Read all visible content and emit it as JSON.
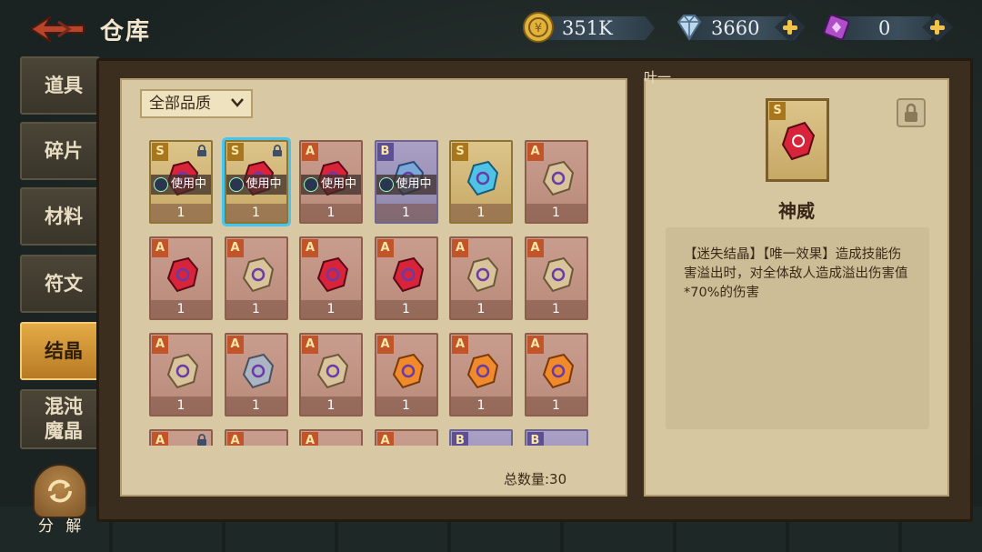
{
  "header": {
    "title": "仓库",
    "gold": "351K",
    "diamonds": "3660",
    "crystals": "0"
  },
  "tabs": [
    {
      "label": "道具",
      "active": false
    },
    {
      "label": "碎片",
      "active": false
    },
    {
      "label": "材料",
      "active": false
    },
    {
      "label": "符文",
      "active": false
    },
    {
      "label": "结晶",
      "active": true
    },
    {
      "label": "混沌魔晶",
      "active": false
    }
  ],
  "decompose_label": "分 解",
  "panel_tag": "叶一",
  "filter": {
    "quality_label": "全部品质"
  },
  "inuse_label": "使用中",
  "items": [
    {
      "rarity": "S",
      "gem": "red",
      "count": "1",
      "in_use": true,
      "locked": true,
      "selected": false
    },
    {
      "rarity": "S",
      "gem": "red",
      "count": "1",
      "in_use": true,
      "locked": true,
      "selected": true
    },
    {
      "rarity": "A",
      "gem": "red",
      "count": "1",
      "in_use": true,
      "locked": false,
      "selected": false
    },
    {
      "rarity": "B",
      "gem": "blue",
      "count": "1",
      "in_use": true,
      "locked": false,
      "selected": false
    },
    {
      "rarity": "S",
      "gem": "cyan",
      "count": "1",
      "in_use": false,
      "locked": false,
      "selected": false
    },
    {
      "rarity": "A",
      "gem": "tan",
      "count": "1",
      "in_use": false,
      "locked": false,
      "selected": false
    },
    {
      "rarity": "A",
      "gem": "red",
      "count": "1",
      "in_use": false,
      "locked": false,
      "selected": false
    },
    {
      "rarity": "A",
      "gem": "tan",
      "count": "1",
      "in_use": false,
      "locked": false,
      "selected": false
    },
    {
      "rarity": "A",
      "gem": "red",
      "count": "1",
      "in_use": false,
      "locked": false,
      "selected": false
    },
    {
      "rarity": "A",
      "gem": "red",
      "count": "1",
      "in_use": false,
      "locked": false,
      "selected": false
    },
    {
      "rarity": "A",
      "gem": "tan",
      "count": "1",
      "in_use": false,
      "locked": false,
      "selected": false
    },
    {
      "rarity": "A",
      "gem": "tan",
      "count": "1",
      "in_use": false,
      "locked": false,
      "selected": false
    },
    {
      "rarity": "A",
      "gem": "tan",
      "count": "1",
      "in_use": false,
      "locked": false,
      "selected": false
    },
    {
      "rarity": "A",
      "gem": "silver",
      "count": "1",
      "in_use": false,
      "locked": false,
      "selected": false
    },
    {
      "rarity": "A",
      "gem": "tan",
      "count": "1",
      "in_use": false,
      "locked": false,
      "selected": false
    },
    {
      "rarity": "A",
      "gem": "orange",
      "count": "1",
      "in_use": false,
      "locked": false,
      "selected": false
    },
    {
      "rarity": "A",
      "gem": "orange",
      "count": "1",
      "in_use": false,
      "locked": false,
      "selected": false
    },
    {
      "rarity": "A",
      "gem": "orange",
      "count": "1",
      "in_use": false,
      "locked": false,
      "selected": false
    },
    {
      "rarity": "A",
      "gem": "green",
      "count": "",
      "in_use": false,
      "locked": true,
      "selected": false
    },
    {
      "rarity": "A",
      "gem": "red",
      "count": "",
      "in_use": false,
      "locked": false,
      "selected": false
    },
    {
      "rarity": "A",
      "gem": "silver",
      "count": "",
      "in_use": false,
      "locked": false,
      "selected": false
    },
    {
      "rarity": "A",
      "gem": "orange",
      "count": "",
      "in_use": false,
      "locked": false,
      "selected": false
    },
    {
      "rarity": "B",
      "gem": "tan",
      "count": "",
      "in_use": false,
      "locked": false,
      "selected": false
    },
    {
      "rarity": "B",
      "gem": "tan",
      "count": "",
      "in_use": false,
      "locked": false,
      "selected": false
    }
  ],
  "total_count": "总数量:30",
  "detail": {
    "rarity": "S",
    "name": "神威",
    "description": "【迷失结晶】【唯一效果】造成技能伤害溢出时，对全体敌人造成溢出伤害值*70%的伤害"
  },
  "colors": {
    "accent_gold": "#e4ab46",
    "selected_outline": "#43c7f0",
    "parchment": "#d8c9a4"
  }
}
